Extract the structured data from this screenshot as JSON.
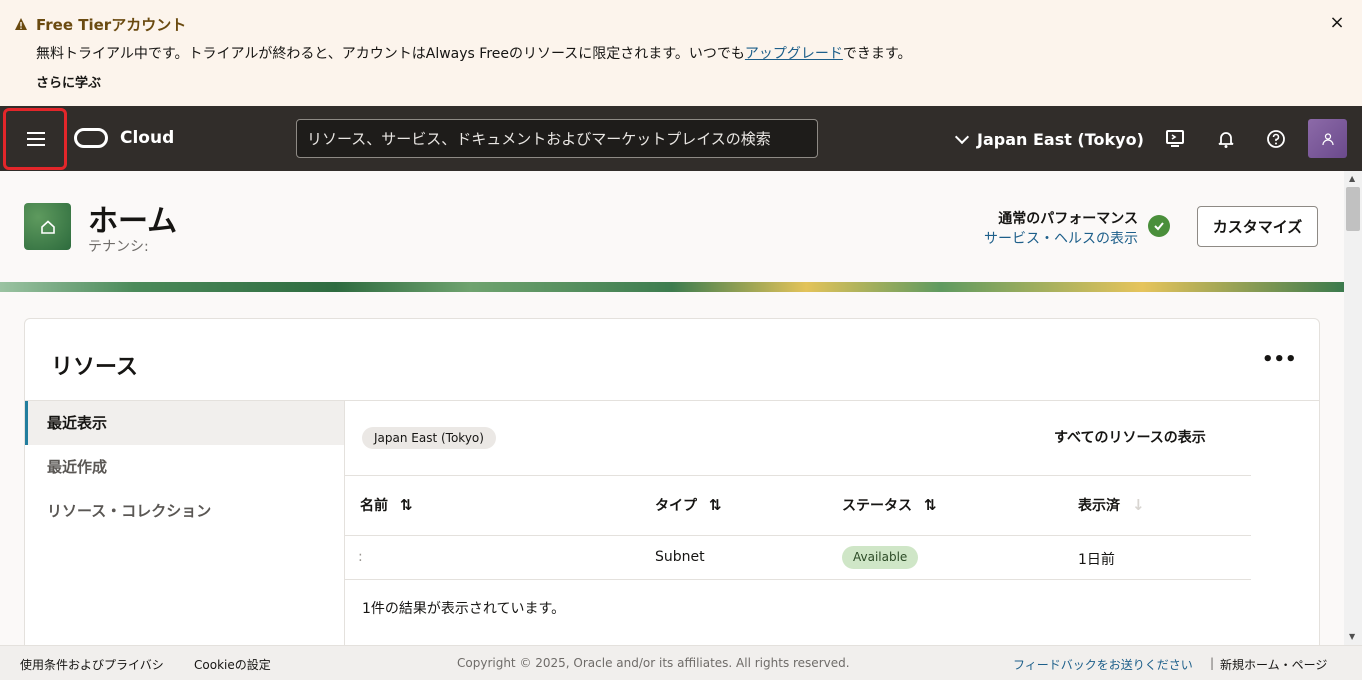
{
  "banner": {
    "title": "Free Tierアカウント",
    "message_prefix": "無料トライアル中です。トライアルが終わると、アカウントはAlways Freeのリソースに限定されます。いつでも",
    "upgrade_link": "アップグレード",
    "message_suffix": "できます。",
    "learn_more": "さらに学ぶ",
    "close": "×"
  },
  "header": {
    "brand": "Cloud",
    "search_placeholder": "リソース、サービス、ドキュメントおよびマーケットプレイスの検索",
    "region": "Japan East (Tokyo)"
  },
  "page": {
    "title": "ホーム",
    "tenancy_label": "テナンシ:",
    "performance_status": "通常のパフォーマンス",
    "service_health_link": "サービス・ヘルスの表示",
    "customize_button": "カスタマイズ"
  },
  "resources": {
    "title": "リソース",
    "more": "•••",
    "nav": [
      {
        "label": "最近表示",
        "active": true
      },
      {
        "label": "最近作成",
        "active": false
      },
      {
        "label": "リソース・コレクション",
        "active": false
      }
    ],
    "region_chip": "Japan East (Tokyo)",
    "view_all": "すべてのリソースの表示",
    "columns": [
      "名前",
      "タイプ",
      "ステータス",
      "表示済"
    ],
    "rows": [
      {
        "name": ":",
        "type": "Subnet",
        "status": "Available",
        "viewed": "1日前"
      }
    ],
    "results_text": "1件の結果が表示されています。"
  },
  "footer": {
    "terms": "使用条件およびプライバシ",
    "cookies": "Cookieの設定",
    "copyright": "Copyright © 2025, Oracle and/or its affiliates. All rights reserved.",
    "feedback": "フィードバックをお送りください",
    "separator": "|",
    "new_home": "新規ホーム・ページ"
  },
  "colors": {
    "header_bg": "#312d2a",
    "banner_bg": "#fcf4ec",
    "link": "#1d5f8a",
    "status_ok": "#4a8f3b",
    "highlight": "#e3262a"
  },
  "icons": [
    "warning-icon",
    "close-icon",
    "hamburger-menu-icon",
    "oracle-logo-icon",
    "chevron-down-icon",
    "cloud-shell-icon",
    "bell-icon",
    "help-icon",
    "user-icon",
    "home-icon",
    "check-circle-icon",
    "sort-icon",
    "more-icon"
  ]
}
